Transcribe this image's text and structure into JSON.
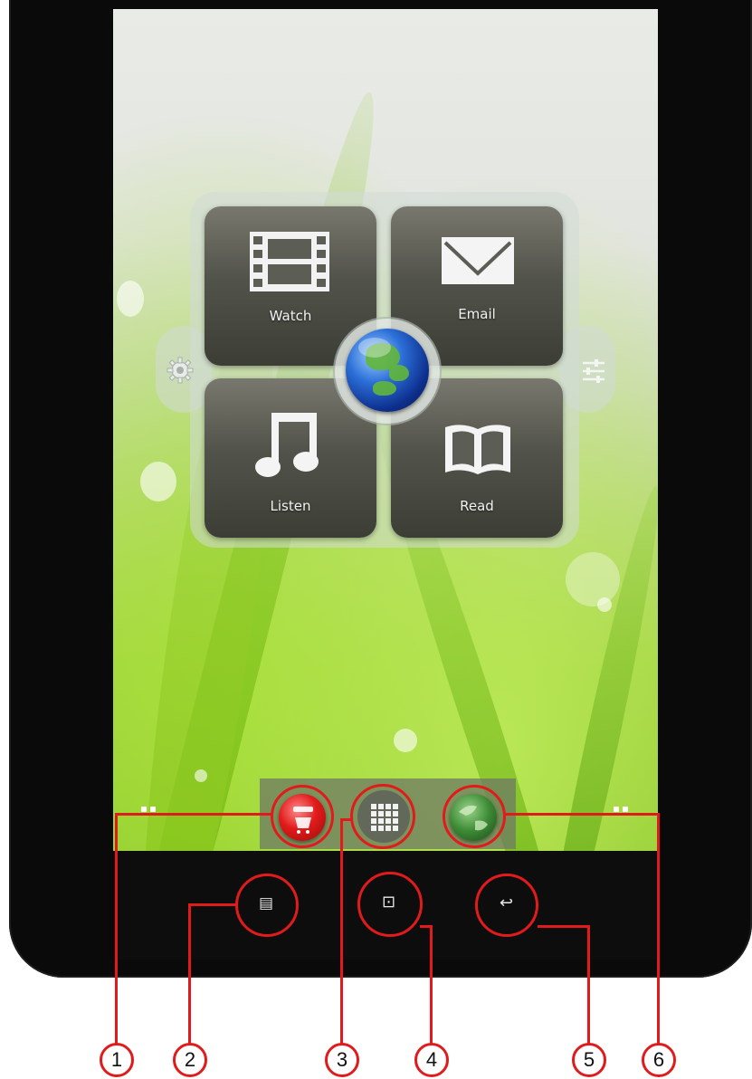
{
  "home_widget": {
    "tiles": [
      {
        "label": "Watch",
        "icon": "film-icon"
      },
      {
        "label": "Email",
        "icon": "envelope-icon"
      },
      {
        "label": "Listen",
        "icon": "music-note-icon"
      },
      {
        "label": "Read",
        "icon": "book-icon"
      }
    ],
    "center_icon": "globe-icon",
    "left_icon": "gear-icon",
    "right_icon": "sliders-icon"
  },
  "dock": {
    "apps": [
      {
        "icon": "app-store-icon",
        "callout": "1"
      },
      {
        "icon": "app-grid-icon",
        "callout": "3"
      },
      {
        "icon": "browser-icon",
        "callout": "6"
      }
    ]
  },
  "nav_bar": {
    "buttons": [
      {
        "icon": "menu-icon",
        "glyph": "▤",
        "callout": "2"
      },
      {
        "icon": "home-icon",
        "glyph": "⊡",
        "callout": "4"
      },
      {
        "icon": "back-icon",
        "glyph": "↩",
        "callout": "5"
      }
    ]
  },
  "callouts": [
    "1",
    "2",
    "3",
    "4",
    "5",
    "6"
  ],
  "colors": {
    "callout_red": "#e11b1b",
    "tile_dark": "#3c3e36",
    "grass_green": "#8ac52b"
  }
}
